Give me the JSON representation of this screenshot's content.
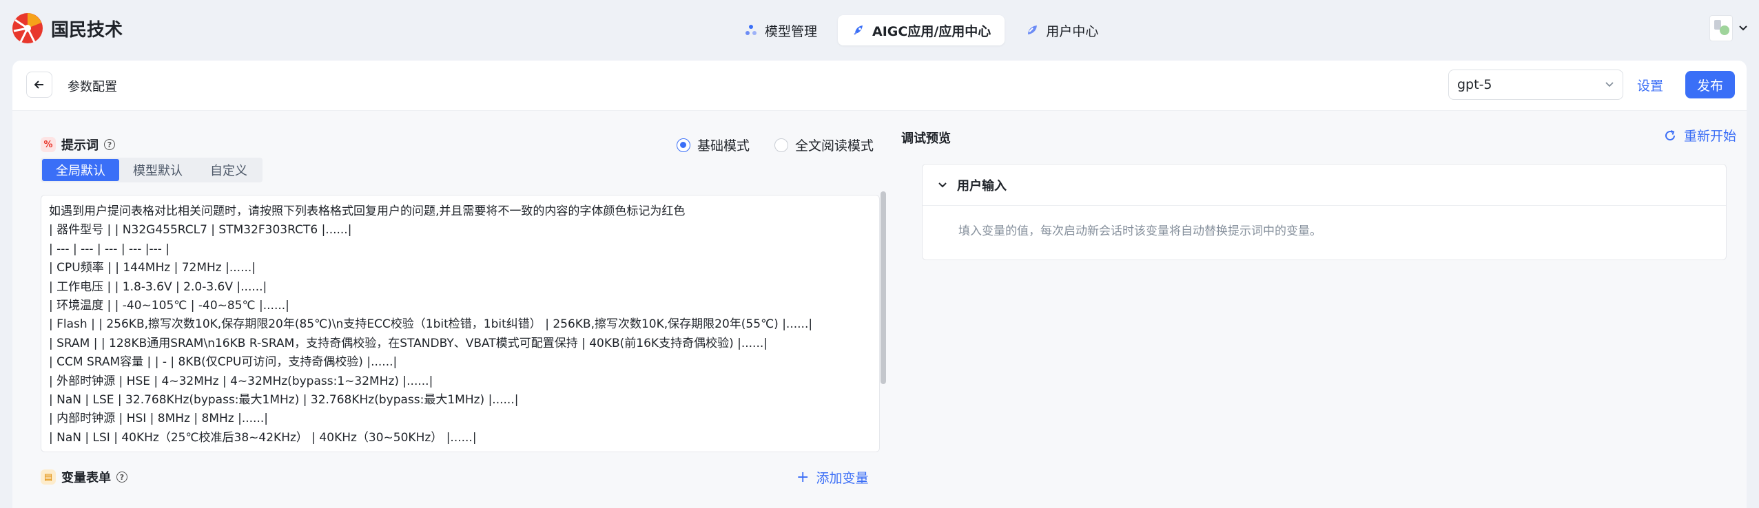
{
  "brand": {
    "name": "国民技术"
  },
  "nav": [
    {
      "label": "模型管理",
      "icon": "model-icon",
      "active": false
    },
    {
      "label": "AIGC应用/应用中心",
      "icon": "rocket-icon",
      "active": true
    },
    {
      "label": "用户中心",
      "icon": "user-center-icon",
      "active": false
    }
  ],
  "header": {
    "title": "参数配置",
    "model": "gpt-5",
    "settings_label": "设置",
    "publish_label": "发布"
  },
  "prompt": {
    "title": "提示词",
    "modes": [
      {
        "label": "基础模式",
        "selected": true
      },
      {
        "label": "全文阅读模式",
        "selected": false
      }
    ],
    "tabs": [
      {
        "label": "全局默认",
        "active": true
      },
      {
        "label": "模型默认",
        "active": false
      },
      {
        "label": "自定义",
        "active": false
      }
    ],
    "lines": [
      "如遇到用户提问表格对比相关问题时，请按照下列表格格式回复用户的问题,并且需要将不一致的内容的字体颜色标记为红色",
      "| 器件型号 |  | N32G455RCL7 |  STM32F303RCT6 |......|",
      "| --- | --- | --- |  --- |--- |",
      "| CPU频率 |  | 144MHz |  72MHz |......|",
      "| 工作电压 |    | 1.8-3.6V | 2.0-3.6V |......|",
      "| 环境温度 |  | -40~105℃ |  -40~85℃ |......|",
      "| Flash |  | 256KB,擦写次数10K,保存期限20年(85℃)\\n支持ECC校验（1bit检错，1bit纠错） | 256KB,擦写次数10K,保存期限20年(55℃) |......|",
      "| SRAM |   | 128KB通用SRAM\\n16KB R-SRAM，支持奇偶校验，在STANDBY、VBAT模式可配置保持 | 40KB(前16K支持奇偶校验) |......|",
      "| CCM SRAM容量 |  | - |  8KB(仅CPU可访问，支持奇偶校验) |......|",
      "| 外部时钟源 | HSE | 4~32MHz |  4~32MHz(bypass:1~32MHz) |......|",
      "| NaN | LSE | 32.768KHz(bypass:最大1MHz) |  32.768KHz(bypass:最大1MHz) |......|",
      "| 内部时钟源 | HSI | 8MHz |  8MHz |......|",
      "| NaN | LSI | 40KHz（25℃校准后38~42KHz） | 40KHz（30~50KHz） |......|"
    ]
  },
  "variables": {
    "title": "变量表单",
    "add_label": "添加变量"
  },
  "preview": {
    "title": "调试预览",
    "restart_label": "重新开始",
    "user_input_title": "用户输入",
    "user_input_hint": "填入变量的值，每次启动新会话时该变量将自动替换提示词中的变量。"
  },
  "colors": {
    "accent": "#3a6ff7",
    "brand_red": "#e8372c",
    "brand_orange": "#f6a21a"
  }
}
